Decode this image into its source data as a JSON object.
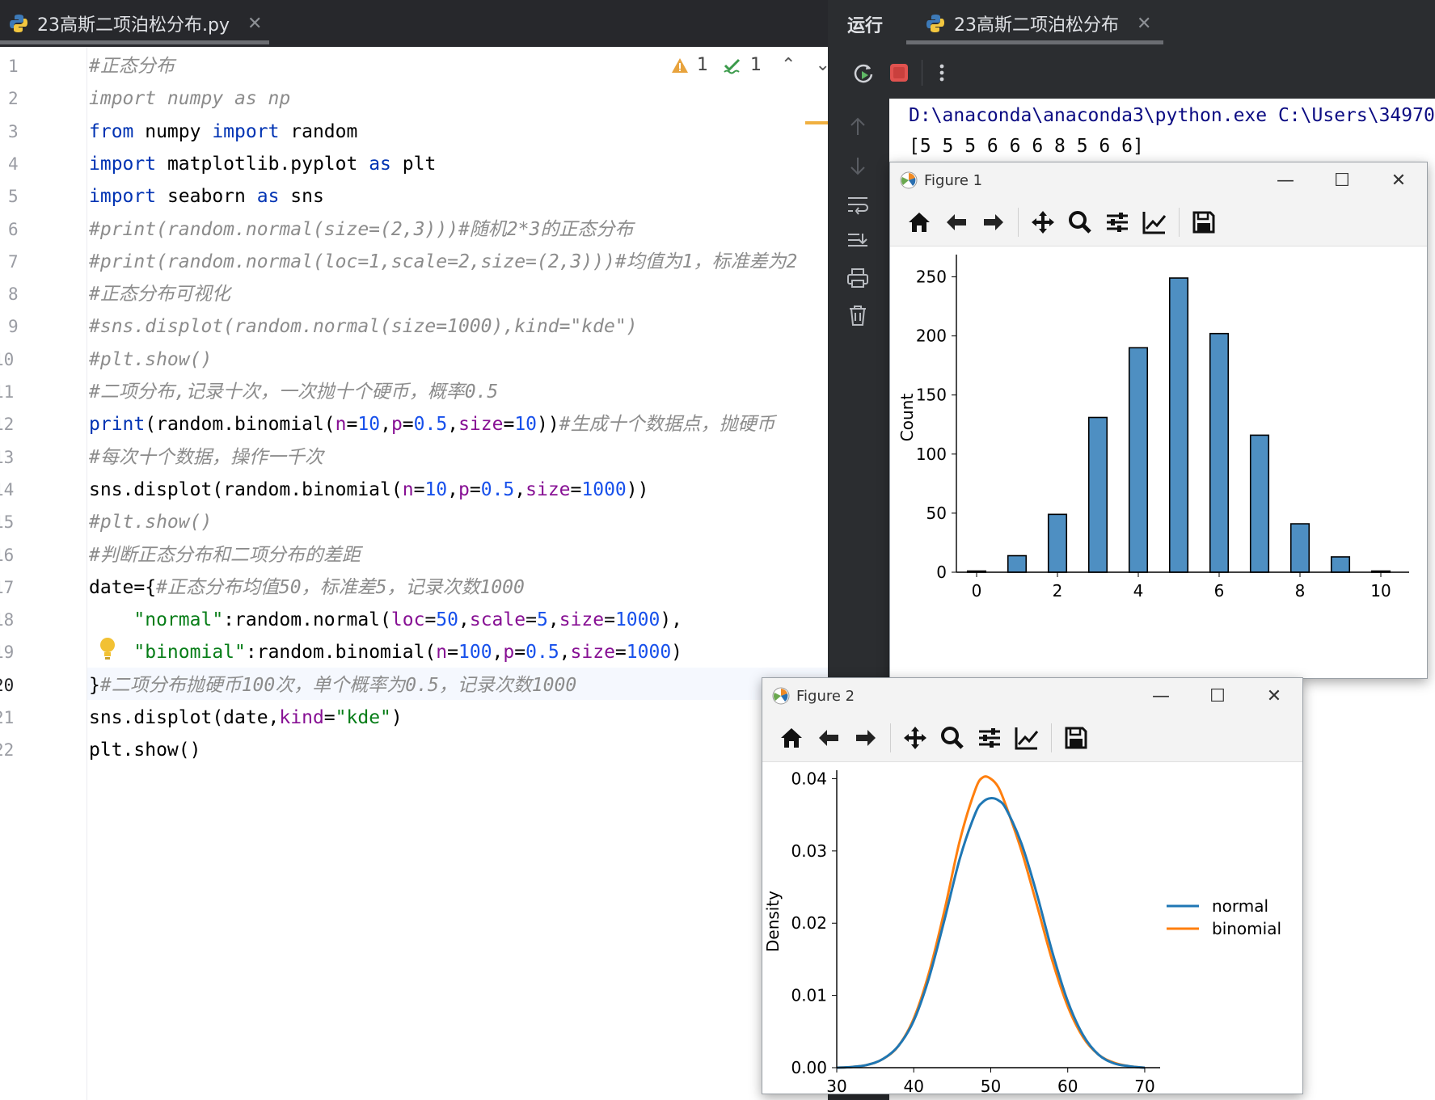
{
  "editor": {
    "tab_title": "23高斯二项泊松分布.py",
    "tab_close": "✕",
    "inspections": {
      "warnings": "1",
      "ok": "1"
    },
    "lines": [
      {
        "n": "1",
        "parts": [
          [
            "cm",
            "#正态分布"
          ]
        ]
      },
      {
        "n": "2",
        "parts": [
          [
            "cm",
            "import numpy as np"
          ]
        ]
      },
      {
        "n": "3",
        "parts": [
          [
            "kw",
            "from"
          ],
          [
            "fn",
            " numpy "
          ],
          [
            "kw",
            "import"
          ],
          [
            "fn",
            " random"
          ]
        ]
      },
      {
        "n": "4",
        "parts": [
          [
            "kw",
            "import"
          ],
          [
            "fn",
            " matplotlib.pyplot "
          ],
          [
            "kw",
            "as"
          ],
          [
            "fn",
            " plt"
          ]
        ]
      },
      {
        "n": "5",
        "parts": [
          [
            "kw",
            "import"
          ],
          [
            "fn",
            " seaborn "
          ],
          [
            "kw",
            "as"
          ],
          [
            "fn",
            " sns"
          ]
        ]
      },
      {
        "n": "6",
        "parts": [
          [
            "cm",
            "#print(random.normal(size=(2,3)))#随机2*3的正态分布"
          ]
        ]
      },
      {
        "n": "7",
        "parts": [
          [
            "cm",
            "#print(random.normal(loc=1,scale=2,size=(2,3)))#均值为1，标准差为2"
          ]
        ]
      },
      {
        "n": "8",
        "parts": [
          [
            "cm",
            "#正态分布可视化"
          ]
        ]
      },
      {
        "n": "9",
        "parts": [
          [
            "cm",
            "#sns.displot(random.normal(size=1000),kind=\"kde\")"
          ]
        ]
      },
      {
        "n": "10",
        "parts": [
          [
            "cm",
            "#plt.show()"
          ]
        ]
      },
      {
        "n": "11",
        "parts": [
          [
            "cm",
            "#二项分布,记录十次，一次抛十个硬币，概率0.5"
          ]
        ]
      },
      {
        "n": "12",
        "parts": [
          [
            "kw",
            "print"
          ],
          [
            "fn",
            "(random.binomial("
          ],
          [
            "pr",
            "n"
          ],
          [
            "fn",
            "="
          ],
          [
            "nu",
            "10"
          ],
          [
            "fn",
            ","
          ],
          [
            "pr",
            "p"
          ],
          [
            "fn",
            "="
          ],
          [
            "nu",
            "0.5"
          ],
          [
            "fn",
            ","
          ],
          [
            "pr",
            "size"
          ],
          [
            "fn",
            "="
          ],
          [
            "nu",
            "10"
          ],
          [
            "fn",
            "))"
          ],
          [
            "cm",
            "#生成十个数据点，抛硬币"
          ]
        ]
      },
      {
        "n": "13",
        "parts": [
          [
            "cm",
            "#每次十个数据，操作一千次"
          ]
        ]
      },
      {
        "n": "14",
        "parts": [
          [
            "fn",
            "sns.displot(random.binomial("
          ],
          [
            "pr",
            "n"
          ],
          [
            "fn",
            "="
          ],
          [
            "nu",
            "10"
          ],
          [
            "fn",
            ","
          ],
          [
            "pr",
            "p"
          ],
          [
            "fn",
            "="
          ],
          [
            "nu",
            "0.5"
          ],
          [
            "fn",
            ","
          ],
          [
            "pr",
            "size"
          ],
          [
            "fn",
            "="
          ],
          [
            "nu",
            "1000"
          ],
          [
            "fn",
            "))"
          ]
        ]
      },
      {
        "n": "15",
        "parts": [
          [
            "cm",
            "#plt.show()"
          ]
        ]
      },
      {
        "n": "16",
        "parts": [
          [
            "cm",
            "#判断正态分布和二项分布的差距"
          ]
        ]
      },
      {
        "n": "17",
        "parts": [
          [
            "fn",
            "date={"
          ],
          [
            "cm",
            "#正态分布均值50，标准差5，记录次数1000"
          ]
        ]
      },
      {
        "n": "18",
        "parts": [
          [
            "fn",
            "    "
          ],
          [
            "st",
            "\"normal\""
          ],
          [
            "fn",
            ":random.normal("
          ],
          [
            "pr",
            "loc"
          ],
          [
            "fn",
            "="
          ],
          [
            "nu",
            "50"
          ],
          [
            "fn",
            ","
          ],
          [
            "pr",
            "scale"
          ],
          [
            "fn",
            "="
          ],
          [
            "nu",
            "5"
          ],
          [
            "fn",
            ","
          ],
          [
            "pr",
            "size"
          ],
          [
            "fn",
            "="
          ],
          [
            "nu",
            "1000"
          ],
          [
            "fn",
            "),"
          ]
        ]
      },
      {
        "n": "19",
        "parts": [
          [
            "fn",
            "    "
          ],
          [
            "st",
            "\"binomial\""
          ],
          [
            "fn",
            ":random.binomial("
          ],
          [
            "pr",
            "n"
          ],
          [
            "fn",
            "="
          ],
          [
            "nu",
            "100"
          ],
          [
            "fn",
            ","
          ],
          [
            "pr",
            "p"
          ],
          [
            "fn",
            "="
          ],
          [
            "nu",
            "0.5"
          ],
          [
            "fn",
            ","
          ],
          [
            "pr",
            "size"
          ],
          [
            "fn",
            "="
          ],
          [
            "nu",
            "1000"
          ],
          [
            "fn",
            ")"
          ]
        ]
      },
      {
        "n": "20",
        "parts": [
          [
            "fn",
            "}"
          ],
          [
            "cm",
            "#二项分布抛硬币100次，单个概率为0.5，记录次数1000"
          ]
        ]
      },
      {
        "n": "21",
        "parts": [
          [
            "fn",
            "sns.displot(date,"
          ],
          [
            "pr",
            "kind"
          ],
          [
            "fn",
            "="
          ],
          [
            "st",
            "\"kde\""
          ],
          [
            "fn",
            ")"
          ]
        ]
      },
      {
        "n": "22",
        "parts": [
          [
            "fn",
            "plt.show()"
          ]
        ]
      }
    ]
  },
  "run": {
    "label": "运行",
    "tab_title": "23高斯二项泊松分布",
    "tab_close": "✕",
    "console": [
      "D:\\anaconda\\anaconda3\\python.exe C:\\Users\\34970",
      "[5 5 5 6 6 6 8 5 6 6]"
    ]
  },
  "figure1": {
    "title": "Figure 1"
  },
  "figure2": {
    "title": "Figure 2"
  },
  "window_buttons": {
    "minimize": "—",
    "maximize": "☐",
    "close": "✕"
  },
  "colors": {
    "blue": "#1f77b4",
    "orange": "#ff7f0e",
    "bar_fill": "#4e8fc2"
  },
  "chart_data": [
    {
      "type": "bar",
      "title": "",
      "xlabel": "",
      "ylabel": "Count",
      "x": [
        0,
        1,
        2,
        3,
        4,
        5,
        6,
        7,
        8,
        9,
        10
      ],
      "values": [
        1,
        14,
        49,
        131,
        190,
        249,
        202,
        116,
        41,
        13,
        1
      ],
      "xticks": [
        "0",
        "2",
        "4",
        "6",
        "8",
        "10"
      ],
      "yticks": [
        "0",
        "50",
        "100",
        "150",
        "200",
        "250"
      ],
      "xlim": [
        -0.5,
        10.5
      ],
      "ylim": [
        0,
        262
      ]
    },
    {
      "type": "line",
      "title": "",
      "xlabel": "",
      "ylabel": "Density",
      "xticks": [
        "30",
        "40",
        "50",
        "60",
        "70"
      ],
      "yticks": [
        "0.00",
        "0.01",
        "0.02",
        "0.03",
        "0.04"
      ],
      "xlim": [
        30,
        72
      ],
      "ylim": [
        0,
        0.0405
      ],
      "legend_position": "center-right",
      "series": [
        {
          "name": "normal",
          "color": "#1f77b4",
          "x": [
            30,
            32,
            34,
            36,
            38,
            40,
            42,
            44,
            46,
            48,
            49,
            50,
            51,
            52,
            54,
            56,
            58,
            60,
            62,
            64,
            66,
            68,
            70
          ],
          "y": [
            0.0,
            0.0001,
            0.0004,
            0.0012,
            0.003,
            0.0065,
            0.0125,
            0.0205,
            0.029,
            0.0352,
            0.0368,
            0.0373,
            0.037,
            0.0358,
            0.031,
            0.024,
            0.016,
            0.0092,
            0.0045,
            0.0018,
            0.0006,
            0.0002,
            0.0
          ]
        },
        {
          "name": "binomial",
          "color": "#ff7f0e",
          "x": [
            30,
            32,
            34,
            36,
            38,
            40,
            42,
            44,
            46,
            48,
            49,
            50,
            51,
            52,
            54,
            56,
            58,
            60,
            62,
            64,
            66,
            68,
            70
          ],
          "y": [
            0.0,
            0.0001,
            0.0004,
            0.0012,
            0.003,
            0.0068,
            0.0132,
            0.0218,
            0.0315,
            0.0385,
            0.0402,
            0.04,
            0.0388,
            0.0362,
            0.03,
            0.0225,
            0.0148,
            0.0085,
            0.0042,
            0.0018,
            0.0007,
            0.0002,
            0.0
          ]
        }
      ]
    }
  ]
}
